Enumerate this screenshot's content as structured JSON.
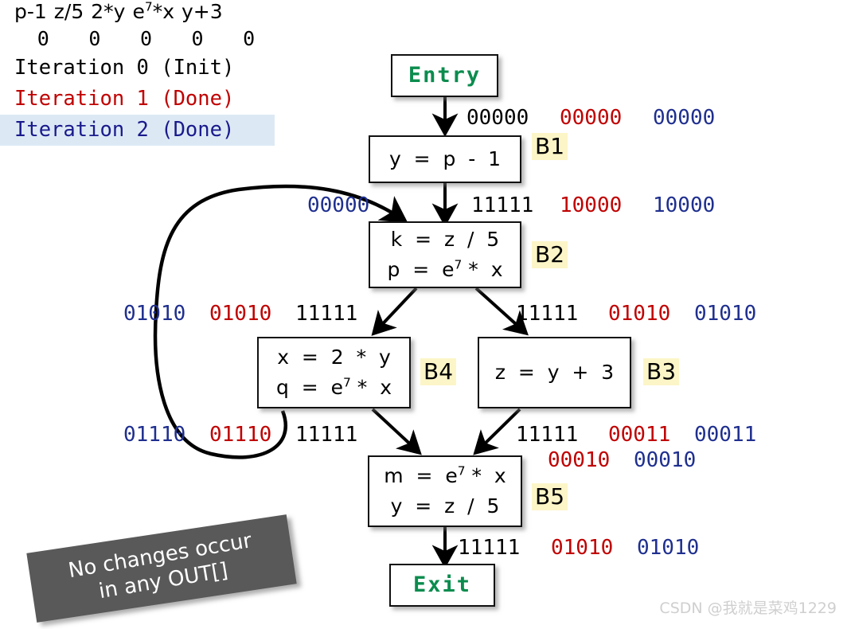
{
  "legend": {
    "expressions": [
      {
        "text": "p-1",
        "sup": ""
      },
      {
        "text": "z/5",
        "sup": ""
      },
      {
        "text": "2*y",
        "sup": ""
      },
      {
        "pre": "e",
        "sup": "7",
        "post": "*x"
      },
      {
        "text": "y+3",
        "sup": ""
      }
    ],
    "zeros": [
      "0",
      "0",
      "0",
      "0",
      "0"
    ],
    "rows": [
      {
        "label": "Iteration 0 (Init)",
        "color": "#000000"
      },
      {
        "label": "Iteration 1 (Done)",
        "color": "#C00000"
      },
      {
        "label": "Iteration 2 (Done)",
        "color": "#1A1A8C",
        "highlight": "#DCE9F5"
      }
    ]
  },
  "nodes": {
    "entry": {
      "label": "Entry"
    },
    "exit": {
      "label": "Exit"
    },
    "b1": {
      "lines": [
        {
          "text": "y  =  p  -  1"
        }
      ],
      "tag": "B1"
    },
    "b2": {
      "lines": [
        {
          "text": "k  =  z  /  5"
        },
        {
          "pre": "p  =  e",
          "sup": "7",
          "post": " *  x"
        }
      ],
      "tag": "B2"
    },
    "b3": {
      "lines": [
        {
          "text": "z  =  y  +  3"
        }
      ],
      "tag": "B3"
    },
    "b4": {
      "lines": [
        {
          "text": "x  =  2  *  y"
        },
        {
          "pre": "q  =  e",
          "sup": "7",
          "post": " *  x"
        }
      ],
      "tag": "B4"
    },
    "b5": {
      "lines": [
        {
          "pre": "m  =  e",
          "sup": "7",
          "post": " *  x"
        },
        {
          "text": "y  =  z  /  5"
        }
      ],
      "tag": "B5"
    }
  },
  "annotations": {
    "entry_to_b1": {
      "black": "00000",
      "red": "00000",
      "blue": "00000"
    },
    "b1_to_b2": {
      "black": "11111",
      "red": "10000",
      "blue": "10000"
    },
    "backedge_b2_in": {
      "blue": "00000"
    },
    "b2_to_b4_left": {
      "blue": "01010",
      "red": "01010",
      "black": "11111"
    },
    "b2_to_b3_right": {
      "black": "11111",
      "red": "01010",
      "blue": "01010"
    },
    "b4_to_b5_left": {
      "blue": "01110",
      "red": "01110",
      "black": "11111"
    },
    "b3_to_b5_right": {
      "black": "11111",
      "red": "00011",
      "blue": "00011"
    },
    "b5_in_second": {
      "red": "00010",
      "blue": "00010"
    },
    "b5_to_exit": {
      "black": "11111",
      "red": "01010",
      "blue": "01010"
    }
  },
  "banner": {
    "line1": "No changes occur",
    "line2": "in any OUT[]"
  },
  "watermark": {
    "text": "CSDN @我就是菜鸡1229"
  },
  "colors": {
    "black": "#000000",
    "red": "#C00000",
    "blue": "#1F2F8F",
    "green": "#0B8C4E",
    "tag_highlight": "#FCF5C7",
    "row_highlight": "#DCE9F5",
    "banner_bg": "#595959"
  }
}
